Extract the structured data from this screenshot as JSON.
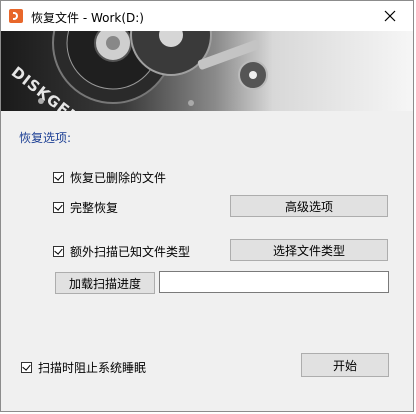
{
  "window": {
    "title": "恢复文件 - Work(D:)",
    "brand": "DISKGENIUS"
  },
  "options": {
    "section_label": "恢复选项:",
    "recover_deleted": {
      "label": "恢复已删除的文件",
      "checked": true
    },
    "full_recover": {
      "label": "完整恢复",
      "checked": true
    },
    "extra_scan": {
      "label": "额外扫描已知文件类型",
      "checked": true
    }
  },
  "buttons": {
    "advanced": "高级选项",
    "select_types": "选择文件类型",
    "load_progress": "加载扫描进度",
    "start": "开始"
  },
  "progress_path": {
    "value": ""
  },
  "footer": {
    "prevent_sleep": {
      "label": "扫描时阻止系统睡眠",
      "checked": true
    }
  },
  "colors": {
    "section_label": "#1c3f94",
    "app_icon": "#e8672a"
  },
  "icons": [
    "app-icon",
    "close-icon",
    "checkbox-check-icon"
  ]
}
